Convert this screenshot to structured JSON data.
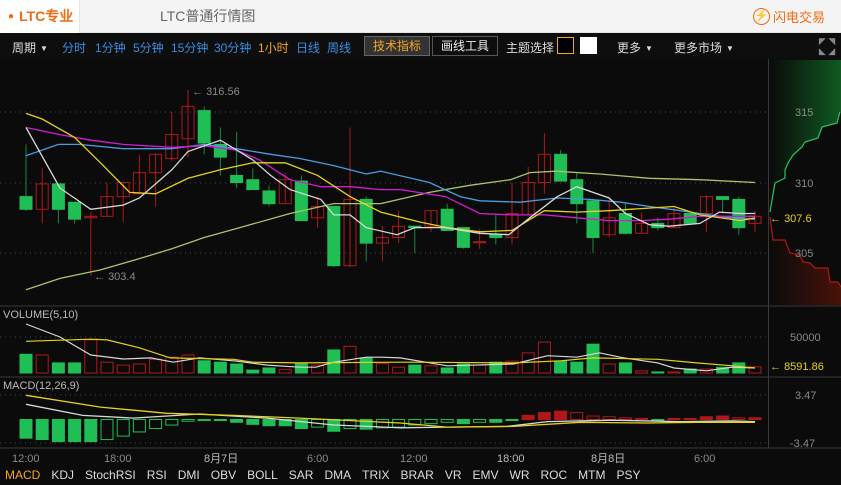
{
  "tabs": [
    {
      "label": "LTC专业行情图",
      "active": true
    },
    {
      "label": "LTC普通行情图",
      "active": false
    }
  ],
  "flash_trade": {
    "label": "闪电交易",
    "icon": "lightning-icon"
  },
  "toolbar": {
    "period_label": "周期",
    "periods": [
      "分时",
      "1分钟",
      "5分钟",
      "15分钟",
      "30分钟",
      "1小时",
      "日线",
      "周线"
    ],
    "active_period": "1小时",
    "tech_indicator": "技术指标",
    "draw_tools": "画线工具",
    "theme_label": "主题选择",
    "more": "更多",
    "more_markets": "更多市场"
  },
  "colors": {
    "up": "#b01818",
    "down": "#1fbf55",
    "accent": "#f5a623",
    "ma5": "#d8d8d8",
    "ma10": "#e6d21e",
    "ma20": "#d21ed2",
    "ma30": "#4a9be0",
    "ma60": "#a9c46c"
  },
  "price_axis": {
    "ticks": [
      "315",
      "310",
      "305"
    ],
    "current": "307.6"
  },
  "annotations": {
    "high": "316.56",
    "low": "303.4"
  },
  "volume": {
    "title": "VOLUME(5,10)",
    "tick": "50000",
    "current": "8591.86"
  },
  "macd": {
    "title": "MACD(12,26,9)",
    "tick_top": "3.47",
    "tick_bottom": "-3.47"
  },
  "time_axis": [
    "12:00",
    "18:00",
    "8月7日",
    "6:00",
    "12:00",
    "18:00",
    "8月8日",
    "6:00"
  ],
  "indicators": [
    "MACD",
    "KDJ",
    "StochRSI",
    "RSI",
    "DMI",
    "OBV",
    "BOLL",
    "SAR",
    "DMA",
    "TRIX",
    "BRAR",
    "VR",
    "EMV",
    "WR",
    "ROC",
    "MTM",
    "PSY"
  ],
  "chart_data": {
    "type": "candlestick",
    "interval": "1h",
    "ohlc": [
      [
        309.0,
        312.7,
        308.0,
        308.1
      ],
      [
        308.1,
        311.0,
        307.1,
        309.9
      ],
      [
        309.9,
        309.9,
        307.1,
        308.1
      ],
      [
        308.6,
        308.6,
        307.1,
        307.4
      ],
      [
        307.5,
        307.9,
        303.4,
        307.6
      ],
      [
        307.6,
        310.0,
        307.6,
        309.0
      ],
      [
        309.0,
        310.0,
        307.2,
        310.0
      ],
      [
        309.2,
        312.0,
        309.2,
        310.7
      ],
      [
        310.7,
        312.1,
        308.3,
        312.0
      ],
      [
        311.7,
        315.0,
        311.5,
        313.4
      ],
      [
        313.1,
        316.56,
        311.8,
        315.4
      ],
      [
        315.1,
        315.4,
        312.0,
        312.8
      ],
      [
        312.7,
        313.9,
        310.5,
        311.8
      ],
      [
        310.5,
        313.6,
        309.6,
        310.0
      ],
      [
        310.2,
        311.0,
        309.5,
        309.5
      ],
      [
        309.4,
        309.8,
        308.3,
        308.5
      ],
      [
        308.5,
        310.7,
        308.5,
        310.2
      ],
      [
        310.1,
        310.5,
        307.3,
        307.3
      ],
      [
        307.5,
        309.0,
        306.8,
        308.3
      ],
      [
        308.3,
        308.3,
        304.0,
        304.1
      ],
      [
        304.1,
        313.9,
        304.0,
        308.8
      ],
      [
        308.8,
        309.0,
        304.4,
        305.7
      ],
      [
        305.7,
        306.9,
        304.4,
        306.1
      ],
      [
        306.1,
        308.0,
        305.7,
        306.9
      ],
      [
        306.9,
        306.9,
        305.0,
        306.8
      ],
      [
        306.9,
        308.0,
        306.5,
        308.0
      ],
      [
        308.1,
        308.5,
        306.6,
        306.6
      ],
      [
        306.8,
        306.8,
        305.3,
        305.4
      ],
      [
        305.8,
        306.7,
        305.3,
        305.8
      ],
      [
        306.3,
        307.7,
        305.6,
        306.1
      ],
      [
        306.1,
        310.0,
        305.6,
        307.8
      ],
      [
        307.7,
        311.1,
        307.7,
        310.0
      ],
      [
        310.0,
        313.5,
        309.2,
        312.0
      ],
      [
        312.0,
        312.3,
        310.1,
        310.1
      ],
      [
        310.2,
        310.7,
        307.1,
        308.5
      ],
      [
        308.7,
        308.7,
        305.0,
        306.1
      ],
      [
        306.3,
        308.8,
        306.1,
        307.5
      ],
      [
        307.8,
        308.5,
        306.3,
        306.4
      ],
      [
        306.4,
        307.9,
        306.4,
        307.1
      ],
      [
        307.1,
        307.5,
        306.6,
        306.8
      ],
      [
        306.8,
        308.2,
        306.8,
        307.8
      ],
      [
        307.8,
        307.8,
        307.1,
        307.1
      ],
      [
        307.8,
        309.1,
        306.5,
        309.0
      ],
      [
        309.0,
        309.0,
        307.8,
        308.8
      ],
      [
        308.8,
        309.0,
        306.3,
        306.8
      ],
      [
        307.1,
        308.0,
        306.5,
        307.6
      ]
    ],
    "ma_lines": {
      "ma5": [
        [
          0,
          313.9
        ],
        [
          2.1,
          309.6
        ],
        [
          4,
          308.1
        ],
        [
          6,
          308.4
        ],
        [
          7,
          308.9
        ],
        [
          9,
          310.9
        ],
        [
          10,
          312.2
        ],
        [
          12,
          313.0
        ],
        [
          14,
          311.6
        ],
        [
          15.1,
          310.5
        ],
        [
          16.3,
          309.5
        ],
        [
          18.2,
          308.8
        ],
        [
          19,
          307.7
        ],
        [
          20,
          307.7
        ],
        [
          21,
          306.8
        ],
        [
          22.9,
          306.3
        ],
        [
          24,
          306.8
        ],
        [
          25.9,
          306.8
        ],
        [
          28,
          306.4
        ],
        [
          29.8,
          306.3
        ],
        [
          31.1,
          307.5
        ],
        [
          32.8,
          309.0
        ],
        [
          34,
          309.7
        ],
        [
          36,
          308.9
        ],
        [
          37,
          307.8
        ],
        [
          38.5,
          307.0
        ],
        [
          39.7,
          306.9
        ],
        [
          41.6,
          307.1
        ],
        [
          42.8,
          307.9
        ],
        [
          44.1,
          307.8
        ],
        [
          45,
          307.8
        ]
      ],
      "ma10": [
        [
          0,
          314.9
        ],
        [
          1,
          314.5
        ],
        [
          3,
          313.2
        ],
        [
          4.6,
          311.4
        ],
        [
          6.4,
          309.3
        ],
        [
          8,
          309.2
        ],
        [
          10,
          310.3
        ],
        [
          12,
          310.9
        ],
        [
          14,
          311.4
        ],
        [
          16,
          311.4
        ],
        [
          18,
          310.5
        ],
        [
          20,
          309.0
        ],
        [
          21.9,
          307.9
        ],
        [
          24.3,
          307.2
        ],
        [
          26,
          306.8
        ],
        [
          28,
          306.5
        ],
        [
          30,
          306.6
        ],
        [
          32,
          308.0
        ],
        [
          34,
          307.9
        ],
        [
          36,
          308.0
        ],
        [
          40,
          308.3
        ],
        [
          41.6,
          307.7
        ],
        [
          44.1,
          307.3
        ],
        [
          45,
          307.5
        ]
      ],
      "ma20": [
        [
          0,
          313.9
        ],
        [
          2.1,
          313.4
        ],
        [
          4,
          313.0
        ],
        [
          6,
          312.7
        ],
        [
          9,
          312.5
        ],
        [
          11,
          312.6
        ],
        [
          13,
          312.3
        ],
        [
          14.4,
          311.6
        ],
        [
          16.3,
          310.2
        ],
        [
          18.2,
          309.7
        ],
        [
          20,
          309.7
        ],
        [
          21.9,
          309.5
        ],
        [
          23.1,
          309.5
        ],
        [
          25.9,
          309.0
        ],
        [
          28,
          307.8
        ],
        [
          29.9,
          307.7
        ],
        [
          32,
          307.7
        ],
        [
          34,
          307.5
        ],
        [
          36,
          307.3
        ],
        [
          37.9,
          307.3
        ],
        [
          39.7,
          307.4
        ],
        [
          41.6,
          307.6
        ],
        [
          45,
          307.6
        ]
      ],
      "ma30": [
        [
          0,
          311.9
        ],
        [
          2,
          312.7
        ],
        [
          3.3,
          312.7
        ],
        [
          6,
          312.4
        ],
        [
          9,
          312.4
        ],
        [
          11,
          312.7
        ],
        [
          13,
          312.4
        ],
        [
          15.1,
          312.0
        ],
        [
          16.9,
          311.7
        ],
        [
          19,
          311.2
        ],
        [
          21,
          310.6
        ],
        [
          21.9,
          310.8
        ],
        [
          24.9,
          310.0
        ],
        [
          26.8,
          309.0
        ],
        [
          28,
          308.7
        ],
        [
          30.5,
          308.6
        ],
        [
          32.8,
          308.9
        ],
        [
          34.8,
          308.8
        ],
        [
          36.7,
          308.6
        ],
        [
          38.5,
          308.3
        ],
        [
          40.4,
          308.0
        ],
        [
          41.6,
          307.8
        ],
        [
          43.5,
          307.5
        ],
        [
          45,
          307.4
        ]
      ],
      "ma60": [
        [
          0,
          302.4
        ],
        [
          2.1,
          303.2
        ],
        [
          4.6,
          303.8
        ],
        [
          7,
          304.6
        ],
        [
          9,
          305.3
        ],
        [
          11,
          306.1
        ],
        [
          13.2,
          306.8
        ],
        [
          16.3,
          307.8
        ],
        [
          19,
          308.5
        ],
        [
          21.9,
          308.5
        ],
        [
          24.9,
          309.3
        ],
        [
          27.4,
          309.8
        ],
        [
          29.9,
          310.2
        ],
        [
          31.1,
          310.7
        ],
        [
          32.7,
          310.8
        ],
        [
          35.4,
          310.6
        ],
        [
          38.5,
          310.3
        ],
        [
          41.6,
          310.2
        ],
        [
          45,
          310.0
        ]
      ]
    },
    "volumes": [
      26000,
      25000,
      14000,
      14000,
      46000,
      15000,
      11000,
      12500,
      19000,
      22000,
      25000,
      17000,
      15000,
      12500,
      4000,
      7000,
      5000,
      12500,
      11000,
      32000,
      37000,
      21000,
      13000,
      8000,
      11000,
      10000,
      7000,
      12500,
      11000,
      15000,
      16500,
      28000,
      43000,
      16500,
      15000,
      40000,
      12500,
      14000,
      3000,
      1500,
      1500,
      5500,
      5500,
      8000,
      14000,
      8591.86
    ],
    "volume_ma5": [
      [
        0,
        68000
      ],
      [
        2.1,
        50000
      ],
      [
        4,
        25000
      ],
      [
        6,
        19500
      ],
      [
        7.7,
        21000
      ],
      [
        9.1,
        15000
      ],
      [
        10.7,
        21000
      ],
      [
        12.8,
        17000
      ],
      [
        14.9,
        11000
      ],
      [
        16.9,
        8000
      ],
      [
        17.9,
        8000
      ],
      [
        19,
        15000
      ],
      [
        21,
        22000
      ],
      [
        21.9,
        22000
      ],
      [
        23.1,
        21000
      ],
      [
        26,
        10000
      ],
      [
        30.1,
        12500
      ],
      [
        32.2,
        24000
      ],
      [
        34,
        22000
      ],
      [
        35.4,
        28000
      ],
      [
        36.9,
        21000
      ],
      [
        39,
        14000
      ],
      [
        40,
        7000
      ],
      [
        42,
        3000
      ],
      [
        43.6,
        8000
      ],
      [
        45,
        7000
      ]
    ],
    "volume_ma10": [
      [
        0,
        44000
      ],
      [
        4,
        47000
      ],
      [
        5,
        46000
      ],
      [
        7,
        35000
      ],
      [
        8.9,
        21000
      ],
      [
        12.8,
        19000
      ],
      [
        14,
        15000
      ],
      [
        16.9,
        14000
      ],
      [
        23.1,
        15000
      ],
      [
        23.9,
        15000
      ],
      [
        30.1,
        14000
      ],
      [
        33,
        17000
      ],
      [
        35,
        21000
      ],
      [
        39,
        19000
      ],
      [
        41.4,
        14000
      ],
      [
        43.6,
        10000
      ],
      [
        45,
        7000
      ]
    ],
    "macd_hist": [
      -2.7,
      -2.9,
      -3.2,
      -3.2,
      -3.2,
      -2.9,
      -2.4,
      -1.8,
      -1.3,
      -0.8,
      -0.25,
      -0.15,
      -0.15,
      -0.4,
      -0.7,
      -0.9,
      -0.9,
      -1.3,
      -1.1,
      -1.7,
      -1.3,
      -1.4,
      -1.2,
      -1.1,
      -0.8,
      -0.6,
      -0.4,
      -0.6,
      -0.4,
      -0.4,
      -0.1,
      0.6,
      1.0,
      1.2,
      1.0,
      0.5,
      0.4,
      0.25,
      0.15,
      -0.05,
      0.15,
      0.15,
      0.4,
      0.5,
      0.25,
      0.25
    ],
    "macd_dif": [
      [
        0,
        2.2
      ],
      [
        3.5,
        0.6
      ],
      [
        6.6,
        0.2
      ],
      [
        10.7,
        0.8
      ],
      [
        14.9,
        0.2
      ],
      [
        19,
        -0.8
      ],
      [
        23.1,
        -1.2
      ],
      [
        26,
        -1.1
      ],
      [
        29.7,
        -1.0
      ],
      [
        32.2,
        -0.3
      ],
      [
        36.2,
        -0.1
      ],
      [
        40.4,
        -0.3
      ],
      [
        43.6,
        -0.2
      ],
      [
        45,
        -0.3
      ]
    ],
    "macd_dea": [
      [
        0,
        3.5
      ],
      [
        4.6,
        1.8
      ],
      [
        8.7,
        0.9
      ],
      [
        12.8,
        0.6
      ],
      [
        16.9,
        0.2
      ],
      [
        23.1,
        -0.5
      ],
      [
        26,
        -1.1
      ],
      [
        30.1,
        -1.0
      ],
      [
        34.2,
        -0.4
      ],
      [
        38.3,
        -0.5
      ],
      [
        41.4,
        -0.4
      ],
      [
        45,
        -0.4
      ]
    ],
    "price_range": [
      301,
      320
    ]
  }
}
